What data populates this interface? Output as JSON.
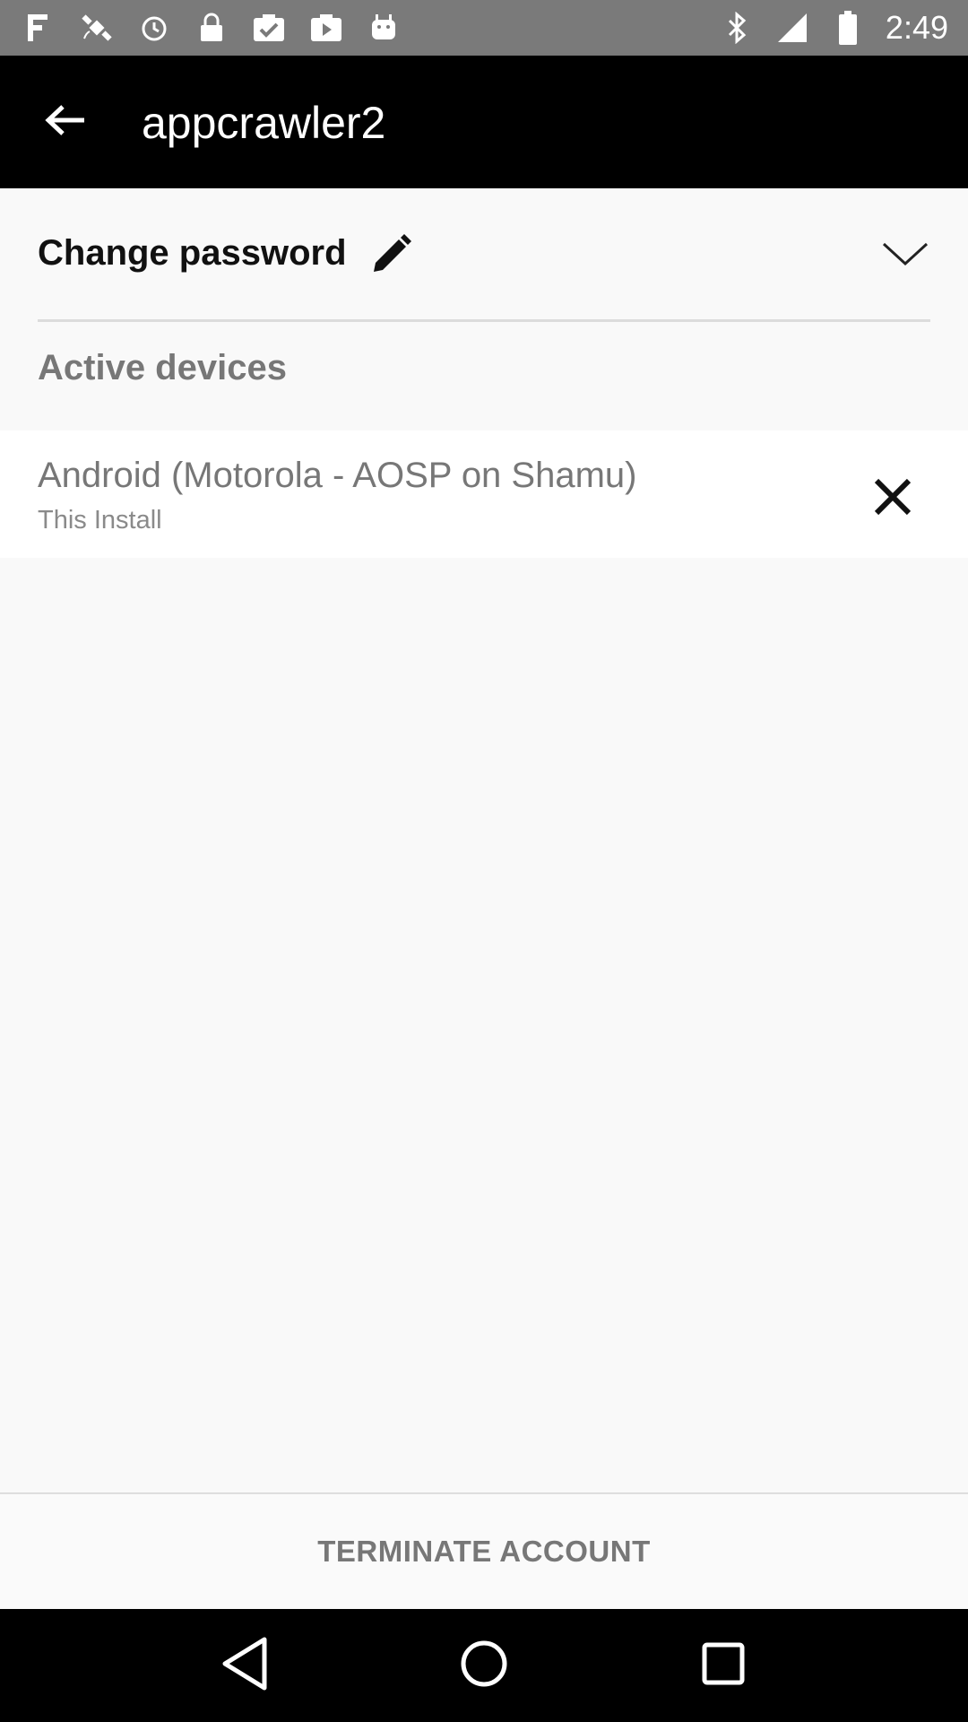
{
  "status_bar": {
    "time": "2:49",
    "left_icons": [
      "notification-f-icon",
      "satellite-icon",
      "alarm-icon",
      "lock-icon",
      "clipboard-check-icon",
      "play-store-icon",
      "android-icon"
    ],
    "right_icons": [
      "bluetooth-icon",
      "signal-icon",
      "battery-icon"
    ]
  },
  "app_bar": {
    "title": "appcrawler2",
    "back_icon": "arrow-back-icon"
  },
  "settings": {
    "change_password_label": "Change password",
    "edit_icon": "pencil-icon",
    "expand_icon": "chevron-down-icon",
    "active_devices_header": "Active devices"
  },
  "devices": [
    {
      "name": "Android (Motorola - AOSP on Shamu)",
      "subtitle": "This Install",
      "remove_icon": "close-icon"
    }
  ],
  "footer": {
    "terminate_label": "TERMINATE ACCOUNT"
  },
  "nav_bar": {
    "icons": [
      "back-triangle-icon",
      "home-circle-icon",
      "recents-square-icon"
    ]
  },
  "colors": {
    "status_bar": "#7a7a7a",
    "app_bar": "#000000",
    "background": "#f9f9f9",
    "muted_text": "#777777"
  }
}
